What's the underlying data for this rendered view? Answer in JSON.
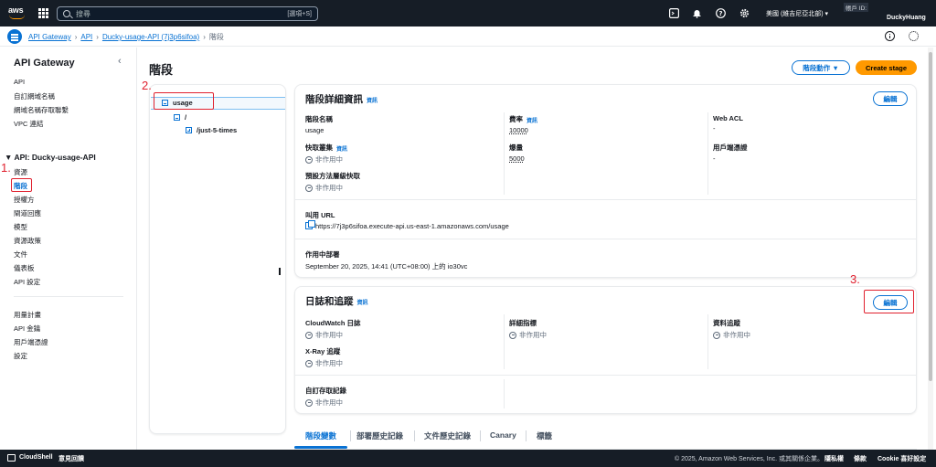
{
  "topnav": {
    "logo_text": "aws",
    "search_placeholder": "搜尋",
    "search_shortcut": "[選項+S]",
    "region": "美國 (維吉尼亞北部) ▾",
    "account_id_label": "帳戶 ID:",
    "user": "DuckyHuang"
  },
  "breadcrumb": {
    "items": [
      "API Gateway",
      "API",
      "Ducky-usage-API (7j3p6sifoa)"
    ],
    "current": "階段"
  },
  "sidebar": {
    "title": "API Gateway",
    "collapse": "‹",
    "top_items": [
      "API",
      "自訂網域名稱",
      "網域名稱存取聯繫",
      "VPC 連結"
    ],
    "section_title": "▼ API: Ducky-usage-API",
    "api_items": [
      "資源",
      "階段",
      "授權方",
      "閘道回應",
      "模型",
      "資源政策",
      "文件",
      "儀表板",
      "API 設定"
    ],
    "bottom_items": [
      "用量計畫",
      "API 金鑰",
      "用戶端憑證",
      "設定"
    ]
  },
  "annotations": [
    "1.",
    "2.",
    "3."
  ],
  "main": {
    "title": "階段",
    "stage_actions": "階段動作 ▼",
    "create_stage": "Create stage"
  },
  "tree": {
    "stage": "usage",
    "root": "/",
    "resource": "/just-5-times"
  },
  "details": {
    "title": "階段詳細資訊",
    "info": "資訊",
    "edit": "編輯",
    "stage_name_label": "階段名稱",
    "stage_name": "usage",
    "rate_label": "費率",
    "rate": "10000",
    "webacl_label": "Web ACL",
    "webacl": "-",
    "cache_label": "快取叢集",
    "cache": "非作用中",
    "burst_label": "爆量",
    "burst": "5000",
    "client_cert_label": "用戶端憑證",
    "client_cert": "-",
    "method_cache_label": "預設方法層級快取",
    "method_cache": "非作用中",
    "invoke_url_label": "叫用 URL",
    "invoke_url": "https://7j3p6sifoa.execute-api.us-east-1.amazonaws.com/usage",
    "deployment_label": "作用中部署",
    "deployment": "September 20, 2025, 14:41 (UTC+08:00) 上的 io30vc"
  },
  "logs": {
    "title": "日誌和追蹤",
    "info": "資訊",
    "edit": "編輯",
    "cloudwatch_label": "CloudWatch 日誌",
    "cloudwatch": "非作用中",
    "metrics_label": "詳細指標",
    "metrics": "非作用中",
    "tracing_label": "資料追蹤",
    "tracing": "非作用中",
    "xray_label": "X-Ray 追蹤",
    "xray": "非作用中",
    "access_label": "自訂存取記錄",
    "access": "非作用中"
  },
  "tabs": [
    "階段變數",
    "部署歷史記錄",
    "文件歷史記錄",
    "Canary",
    "標籤"
  ],
  "footer": {
    "cloudshell": "CloudShell",
    "feedback": "意見回饋",
    "copyright": "© 2025, Amazon Web Services, Inc. 或其關係企業。",
    "privacy": "隱私權",
    "terms": "條款",
    "cookie": "Cookie 喜好設定"
  }
}
